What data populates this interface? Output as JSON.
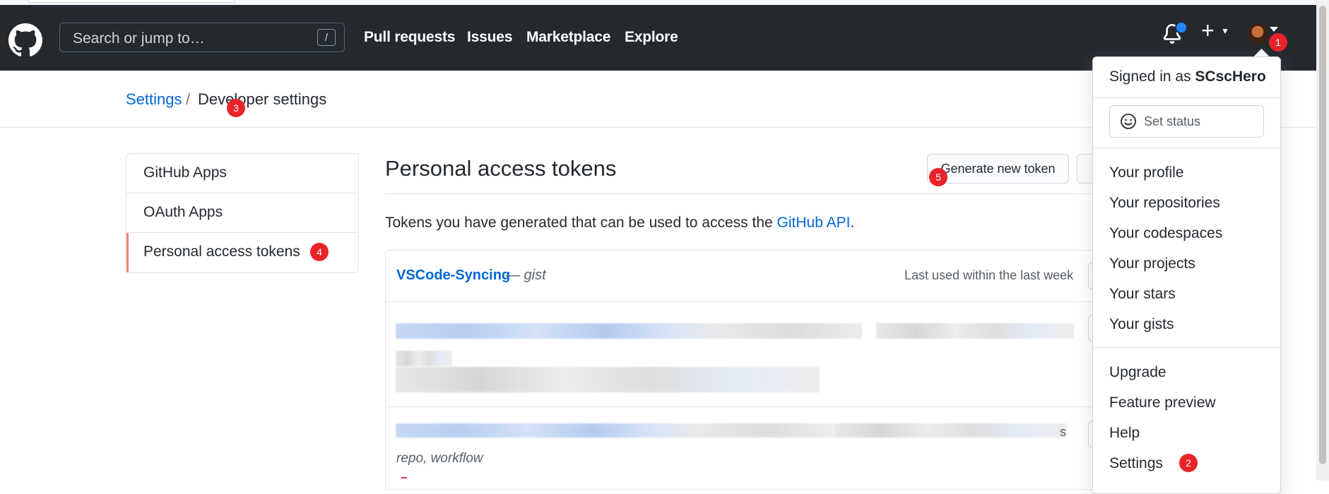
{
  "header": {
    "search_placeholder": "Search or jump to…",
    "search_shortcut": "/",
    "nav": [
      "Pull requests",
      "Issues",
      "Marketplace",
      "Explore"
    ],
    "plus_label": "+"
  },
  "breadcrumb": {
    "settings": "Settings",
    "separator": "/",
    "current": "Developer settings"
  },
  "sidebar": {
    "items": [
      {
        "label": "GitHub Apps"
      },
      {
        "label": "OAuth Apps"
      },
      {
        "label": "Personal access tokens",
        "selected": true
      }
    ]
  },
  "main": {
    "title": "Personal access tokens",
    "generate_button": "Generate new token",
    "description_prefix": "Tokens you have generated that can be used to access the ",
    "description_link": "GitHub API",
    "description_suffix": ".",
    "tokens": [
      {
        "name": "VSCode-Syncing",
        "note": "— gist",
        "last_used": "Last used within the last week"
      },
      {
        "scopes": "repo, workflow",
        "tail": "s"
      }
    ]
  },
  "dropdown": {
    "signed_in_prefix": "Signed in as ",
    "username": "SCscHero",
    "set_status": "Set status",
    "group1": [
      "Your profile",
      "Your repositories",
      "Your codespaces",
      "Your projects",
      "Your stars",
      "Your gists"
    ],
    "group2": [
      "Upgrade",
      "Feature preview",
      "Help",
      "Settings"
    ]
  },
  "markers": [
    "1",
    "2",
    "3",
    "4",
    "5"
  ],
  "colors": {
    "header_bg": "#24292e",
    "link": "#0366d6",
    "selected_accent": "#f9826c",
    "marker": "#e8242a",
    "notification_dot": "#2188ff"
  }
}
